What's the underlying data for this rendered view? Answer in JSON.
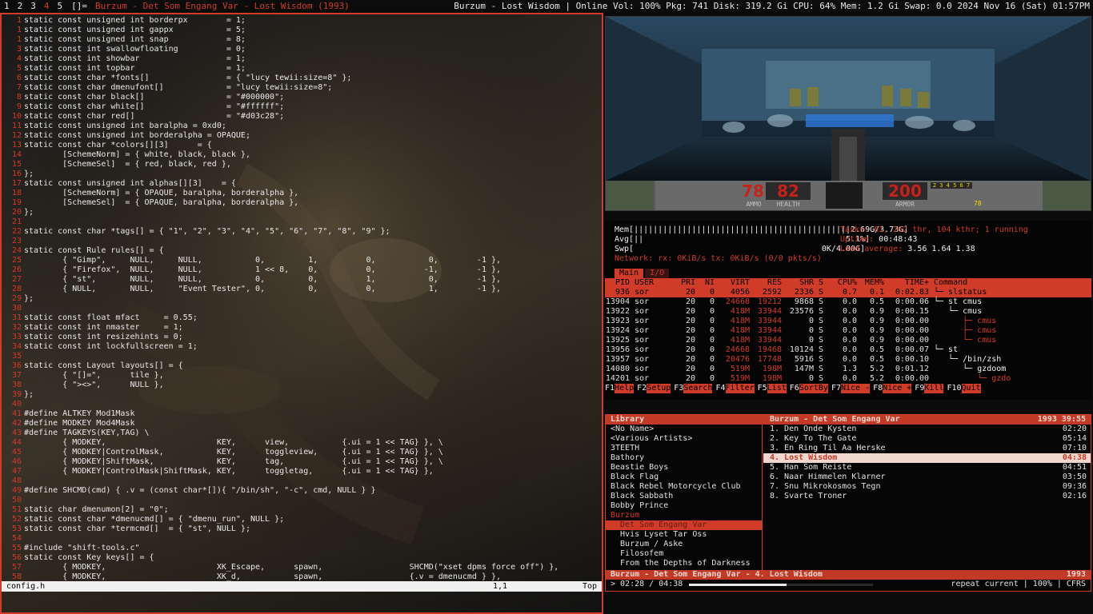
{
  "bar": {
    "tags": [
      "1",
      "2",
      "3",
      "4",
      "5"
    ],
    "active_tag": "4",
    "layout": "[]=",
    "window_title": "Burzum - Det Som Engang Var - Lost Wisdom (1993)",
    "status": "Burzum - Lost Wisdom  |  Online  Vol: 100%  Pkg: 741  Disk: 319.2 Gi  CPU: 64%  Mem: 1.2 Gi  Swap: 0.0  2024 Nov 16 (Sat) 01:57PM"
  },
  "editor": {
    "lines": [
      [
        "1",
        "static const unsigned int borderpx        = 1;"
      ],
      [
        "1",
        "static const unsigned int gappx           = 5;"
      ],
      [
        "1",
        "static const unsigned int snap            = 8;"
      ],
      [
        "3",
        "static const int swallowfloating          = 0;"
      ],
      [
        "4",
        "static const int showbar                  = 1;"
      ],
      [
        "5",
        "static const int topbar                   = 1;"
      ],
      [
        "6",
        "static const char *fonts[]                = { \"lucy tewii:size=8\" };"
      ],
      [
        "7",
        "static const char dmenufont[]             = \"lucy tewii:size=8\";"
      ],
      [
        "8",
        "static const char black[]                 = \"#000000\";"
      ],
      [
        "9",
        "static const char white[]                 = \"#ffffff\";"
      ],
      [
        "10",
        "static const char red[]                   = \"#d03c28\";"
      ],
      [
        "11",
        "static const unsigned int baralpha = 0xd0;"
      ],
      [
        "12",
        "static const unsigned int borderalpha = OPAQUE;"
      ],
      [
        "13",
        "static const char *colors[][3]      = {"
      ],
      [
        "14",
        "        [SchemeNorm] = { white, black, black },"
      ],
      [
        "15",
        "        [SchemeSel]  = { red, black, red },"
      ],
      [
        "16",
        "};"
      ],
      [
        "17",
        "static const unsigned int alphas[][3]    = {"
      ],
      [
        "18",
        "        [SchemeNorm] = { OPAQUE, baralpha, borderalpha },"
      ],
      [
        "19",
        "        [SchemeSel]  = { OPAQUE, baralpha, borderalpha },"
      ],
      [
        "20",
        "};"
      ],
      [
        "21",
        ""
      ],
      [
        "22",
        "static const char *tags[] = { \"1\", \"2\", \"3\", \"4\", \"5\", \"6\", \"7\", \"8\", \"9\" };"
      ],
      [
        "23",
        ""
      ],
      [
        "24",
        "static const Rule rules[] = {"
      ],
      [
        "25",
        "        { \"Gimp\",     NULL,     NULL,           0,         1,          0,           0,        -1 },"
      ],
      [
        "26",
        "        { \"Firefox\",  NULL,     NULL,           1 << 8,    0,          0,          -1,        -1 },"
      ],
      [
        "27",
        "        { \"st\",       NULL,     NULL,           0,         0,          1,           0,        -1 },"
      ],
      [
        "28",
        "        { NULL,       NULL,     \"Event Tester\", 0,         0,          0,           1,        -1 },"
      ],
      [
        "29",
        "};"
      ],
      [
        "30",
        ""
      ],
      [
        "31",
        "static const float mfact     = 0.55;"
      ],
      [
        "32",
        "static const int nmaster     = 1;"
      ],
      [
        "33",
        "static const int resizehints = 0;"
      ],
      [
        "34",
        "static const int lockfullscreen = 1;"
      ],
      [
        "35",
        ""
      ],
      [
        "36",
        "static const Layout layouts[] = {"
      ],
      [
        "37",
        "        { \"[]=\",      tile },"
      ],
      [
        "38",
        "        { \"><>\",      NULL },"
      ],
      [
        "39",
        "};"
      ],
      [
        "40",
        ""
      ],
      [
        "41",
        "#define ALTKEY Mod1Mask"
      ],
      [
        "42",
        "#define MODKEY Mod4Mask"
      ],
      [
        "43",
        "#define TAGKEYS(KEY,TAG) \\"
      ],
      [
        "44",
        "        { MODKEY,                       KEY,      view,           {.ui = 1 << TAG} }, \\"
      ],
      [
        "45",
        "        { MODKEY|ControlMask,           KEY,      toggleview,     {.ui = 1 << TAG} }, \\"
      ],
      [
        "46",
        "        { MODKEY|ShiftMask,             KEY,      tag,            {.ui = 1 << TAG} }, \\"
      ],
      [
        "47",
        "        { MODKEY|ControlMask|ShiftMask, KEY,      toggletag,      {.ui = 1 << TAG} },"
      ],
      [
        "48",
        ""
      ],
      [
        "49",
        "#define SHCMD(cmd) { .v = (const char*[]){ \"/bin/sh\", \"-c\", cmd, NULL } }"
      ],
      [
        "50",
        ""
      ],
      [
        "51",
        "static char dmenumon[2] = \"0\";"
      ],
      [
        "52",
        "static const char *dmenucmd[] = { \"dmenu_run\", NULL };"
      ],
      [
        "53",
        "static const char *termcmd[]  = { \"st\", NULL };"
      ],
      [
        "54",
        ""
      ],
      [
        "55",
        "#include \"shift-tools.c\""
      ],
      [
        "56",
        "static const Key keys[] = {"
      ],
      [
        "57",
        "        { MODKEY,                       XK_Escape,      spawn,                  SHCMD(\"xset dpms force off\") },"
      ],
      [
        "58",
        "        { MODKEY,                       XK_d,           spawn,                  {.v = dmenucmd } },"
      ]
    ],
    "status_file": "config.h",
    "status_pos": "1,1",
    "status_pct": "Top"
  },
  "doom": {
    "ammo": "78",
    "ammo_label": "AMMO",
    "health": "82",
    "health_label": "HEALTH",
    "armor": "200",
    "armor_label": "ARMOR",
    "arms": "2 3 4 5 6 7",
    "keys_small": "78"
  },
  "htop": {
    "mem_line": "Mem[|||||||||||||||||||||||||||||||||||||||||||||2.69G/3.73G]",
    "avg_line": "Avg[||                                          5.1%]",
    "swp_line": "Swp[                                       0K/4.00G]",
    "tasks_label": "Tasks: ",
    "tasks_value": "61, 262 thr, 104 kthr; 1 running",
    "uptime_label": "Uptime: ",
    "uptime_value": "00:48:43",
    "load_label": "Load average: ",
    "load_value": "3.56 1.64 1.38",
    "net_line": "Network: rx: 0KiB/s tx: 0KiB/s (0/0 pkts/s)",
    "tab_main": "Main",
    "tab_io": "I/O",
    "columns": [
      "PID",
      "USER",
      "PRI",
      "NI",
      "VIRT",
      "RES",
      "SHR",
      "S",
      "CPU%",
      "MEM%",
      "TIME+",
      "Command"
    ],
    "processes": [
      [
        "936",
        "sor",
        "20",
        "0",
        "4056",
        "2592",
        "2336",
        "S",
        "0.7",
        "0.1",
        "0:02.83",
        "└─ slstatus"
      ],
      [
        "13904",
        "sor",
        "20",
        "0",
        "24668",
        "19212",
        "9868",
        "S",
        "0.0",
        "0.5",
        "0:00.06",
        "└─ st cmus"
      ],
      [
        "13922",
        "sor",
        "20",
        "0",
        "418M",
        "33944",
        "23576",
        "S",
        "0.0",
        "0.9",
        "0:00.15",
        "   └─ cmus"
      ],
      [
        "13923",
        "sor",
        "20",
        "0",
        "418M",
        "33944",
        "0",
        "S",
        "0.0",
        "0.9",
        "0:00.00",
        "      ├─ cmus"
      ],
      [
        "13924",
        "sor",
        "20",
        "0",
        "418M",
        "33944",
        "0",
        "S",
        "0.0",
        "0.9",
        "0:00.00",
        "      ├─ cmus"
      ],
      [
        "13925",
        "sor",
        "20",
        "0",
        "418M",
        "33944",
        "0",
        "S",
        "0.0",
        "0.9",
        "0:00.00",
        "      └─ cmus"
      ],
      [
        "13956",
        "sor",
        "20",
        "0",
        "24668",
        "19468",
        "10124",
        "S",
        "0.0",
        "0.5",
        "0:00.07",
        "└─ st"
      ],
      [
        "13957",
        "sor",
        "20",
        "0",
        "20476",
        "17748",
        "5916",
        "S",
        "0.0",
        "0.5",
        "0:00.10",
        "   └─ /bin/zsh"
      ],
      [
        "14080",
        "sor",
        "20",
        "0",
        "519M",
        "198M",
        "147M",
        "S",
        "1.3",
        "5.2",
        "0:01.12",
        "      └─ gzdoom"
      ],
      [
        "14201",
        "sor",
        "20",
        "0",
        "519M",
        "198M",
        "0",
        "S",
        "0.0",
        "5.2",
        "0:00.00",
        "         └─ gzdo"
      ]
    ],
    "fkeys": [
      [
        "F1",
        "Help"
      ],
      [
        "F2",
        "Setup"
      ],
      [
        "F3",
        "Search"
      ],
      [
        "F4",
        "Filter"
      ],
      [
        "F5",
        "List"
      ],
      [
        "F6",
        "SortBy"
      ],
      [
        "F7",
        "Nice -"
      ],
      [
        "F8",
        "Nice +"
      ],
      [
        "F9",
        "Kill"
      ],
      [
        "F10",
        "Quit"
      ]
    ]
  },
  "cmus": {
    "lib_title": "Library",
    "album_title": "Burzum - Det Som Engang Var",
    "album_meta": "1993 39:55",
    "library": [
      "<No Name>",
      "<Various Artists>",
      "3TEETH",
      "Bathory",
      "Beastie Boys",
      "Black Flag",
      "Black Rebel Motorcycle Club",
      "Black Sabbath",
      "Bobby Prince",
      "Burzum",
      "  Det Som Engang Var",
      "  Hvis Lyset Tar Oss",
      "  Burzum / Aske",
      "  Filosofem",
      "  From the Depths of Darkness"
    ],
    "library_current_artist": "Burzum",
    "library_selected": "  Det Som Engang Var",
    "tracks": [
      [
        "1. Den Onde Kysten",
        "02:20"
      ],
      [
        "2. Key To The Gate",
        "05:14"
      ],
      [
        "3. En Ring Til Aa Herske",
        "07:10"
      ],
      [
        "4. Lost Wisdom",
        "04:38"
      ],
      [
        "5. Han Som Reiste",
        "04:51"
      ],
      [
        "6. Naar Himmelen Klarner",
        "03:50"
      ],
      [
        "7. Snu Mikrokosmos Tegn",
        "09:36"
      ],
      [
        "8. Svarte Troner",
        "02:16"
      ]
    ],
    "selected_track": "4. Lost Wisdom",
    "now_playing": "Burzum - Det Som Engang Var - 4. Lost Wisdom",
    "now_year": "1993",
    "time_text": "> 02:28 / 04:38",
    "progress": 0.53,
    "status_right": "repeat current | 100% | CFRS"
  },
  "colors": {
    "accent": "#d03c28",
    "bg": "#0b0b0b",
    "fg": "#e8e8e8"
  }
}
